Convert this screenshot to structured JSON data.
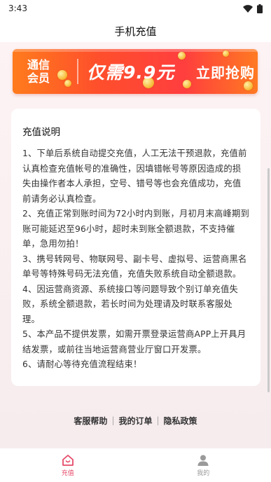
{
  "status_bar": {
    "time": "3:43"
  },
  "header": {
    "title": "手机充值"
  },
  "banner": {
    "tag_line1": "通信",
    "tag_line2": "会员",
    "price": "仅需9.9元",
    "cta": "立即抢购"
  },
  "notice": {
    "title": "充值说明",
    "items": [
      "1、下单后系统自动提交充值，人工无法干预退款，充值前认真检查充值帐号的准确性，因填错帐号等原因造成的损失由操作者本人承担，空号、错号等也会充值成功，充值前请务必认真检查。",
      "2、充值正常到账时间为72小时内到账，月初月末高峰期到账可能延迟至96小时，超时未到账全额退款，不支持催单，急用勿拍！",
      "3、携号转网号、物联网号、副卡号、虚拟号、运营商黑名单号等特殊号码无法充值，充值失败系统自动全额退款。",
      "4、因运营商资源、系统接口等问题导致个别订单充值失败，系统全额退款，若长时间为处理请及时联系客服处理。",
      "5、本产品不提供发票，如需开票登录运营商APP上开具月结发票，或前往当地运营商营业厅窗口开发票。",
      "6、请耐心等待充值流程结束！"
    ]
  },
  "footer_links": {
    "help": "客服帮助",
    "sep": "|",
    "orders": "我的订单",
    "privacy": "隐私政策"
  },
  "tab_bar": {
    "recharge": "充值",
    "mine": "我的"
  },
  "colors": {
    "accent": "#e64a6a",
    "banner_start": "#ff7b1c",
    "banner_mid": "#ff3e3e"
  }
}
